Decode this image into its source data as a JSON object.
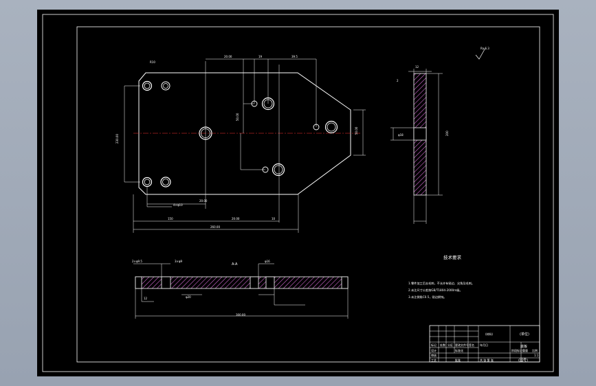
{
  "drawing": {
    "tech_requirements": {
      "title": "技术要求",
      "items": [
        "1.零件加工后去毛刺，不允许有锐边、尖角及毛刺。",
        "2.未注尺寸公差按GB/T1804-2000m级。",
        "3.未注倒角C0.5，锐边倒钝。"
      ]
    },
    "surface_finish": "Ra 6.3",
    "dimensions": {
      "top_r": "R10",
      "top_a": "20.00",
      "top_b": "19",
      "top_c": "39.5",
      "vert_left": "230.00",
      "vert_mid": "50.00",
      "right_h": "50.00",
      "bot_small": "4×φ10",
      "bot_a": "150",
      "bot_b": "20.00",
      "bot_c": "10",
      "bot_total": "260.00",
      "bot_d": "20.00",
      "side_w": "12",
      "side_h": "200",
      "side_hole": "φ18",
      "side_c": "2",
      "sec_a": "2×φ9.5",
      "sec_b": "3×φ9",
      "sec_c": "A-A",
      "sec_d": "φ16",
      "sec_e": "φ20",
      "sec_total": "300.00",
      "sec_f": "12"
    },
    "title_block": {
      "part_name": "底板",
      "material": "(材料)",
      "unit": "(单位)",
      "scale": "1:1",
      "drawing_no": "(图号)",
      "mark": "标记",
      "count": "处数",
      "zone": "分区",
      "change": "更改文件号",
      "sign": "签名",
      "date": "年月日",
      "design": "设计",
      "standard": "标准化",
      "review": "审核",
      "process": "工艺",
      "approve": "批准",
      "stage": "阶段标记",
      "weight": "重量",
      "ratio": "比例",
      "sheet": "共 张 第 张"
    }
  }
}
